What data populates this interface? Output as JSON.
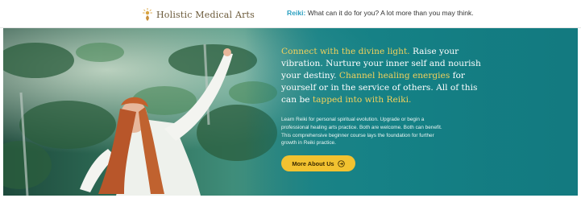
{
  "header": {
    "logo_text": "Holistic Medical Arts",
    "logo_icon": "lotus-sun-icon",
    "tagline_accent": "Reiki:",
    "tagline_rest": " What can it do for you? A lot more than you may think."
  },
  "hero": {
    "headline": {
      "p1": "Connect with the divine light.",
      "p2": " Raise your vibration. Nurture your inner self and nourish your destiny. ",
      "p3": "Channel healing energies",
      "p4": " for yourself or in the service of others. All of this can be ",
      "p5": "tapped into with Reiki."
    },
    "body": "Learn Reiki for personal spiritual evolution. Upgrade or begin a professional healing arts practice. Both are welcome. Both can benefit. This comprehensive beginner course lays the foundation for further growth in Reiki practice.",
    "cta_label": "More About Us",
    "cta_icon": "arrow-right-circle-icon"
  },
  "colors": {
    "accent_blue": "#2a9fc0",
    "gold": "#f2d15c",
    "button": "#f2c230",
    "teal": "#168287"
  }
}
